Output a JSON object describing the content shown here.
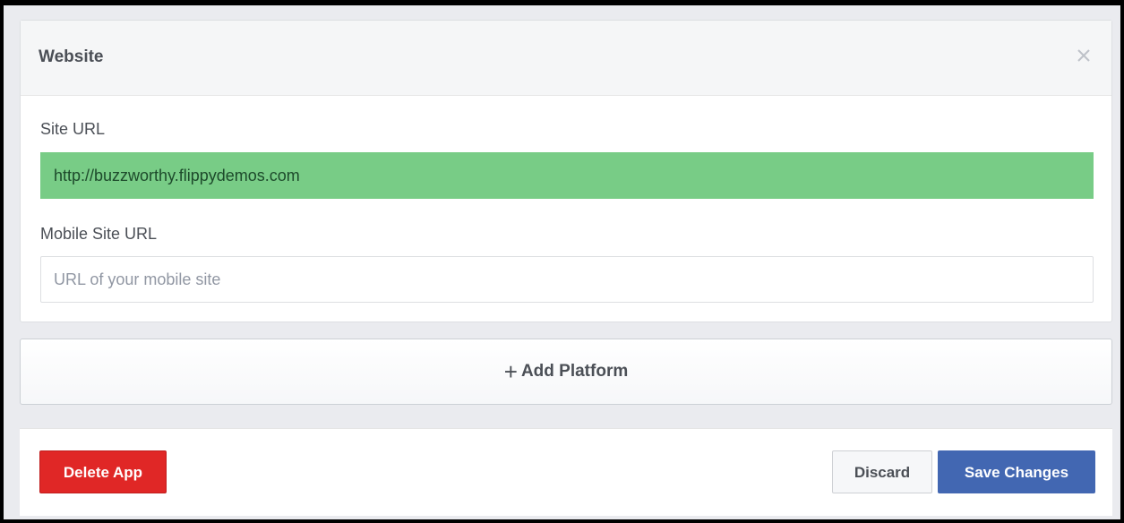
{
  "panel": {
    "title": "Website",
    "site_url": {
      "label": "Site URL",
      "value": "http://buzzworthy.flippydemos.com"
    },
    "mobile_site_url": {
      "label": "Mobile Site URL",
      "placeholder": "URL of your mobile site",
      "value": ""
    }
  },
  "add_platform": {
    "icon": "plus-icon",
    "label": "Add Platform"
  },
  "footer": {
    "delete_label": "Delete App",
    "discard_label": "Discard",
    "save_label": "Save Changes"
  },
  "colors": {
    "valid_field": "#78cc86",
    "delete_button": "#e02726",
    "save_button": "#4267b2"
  }
}
